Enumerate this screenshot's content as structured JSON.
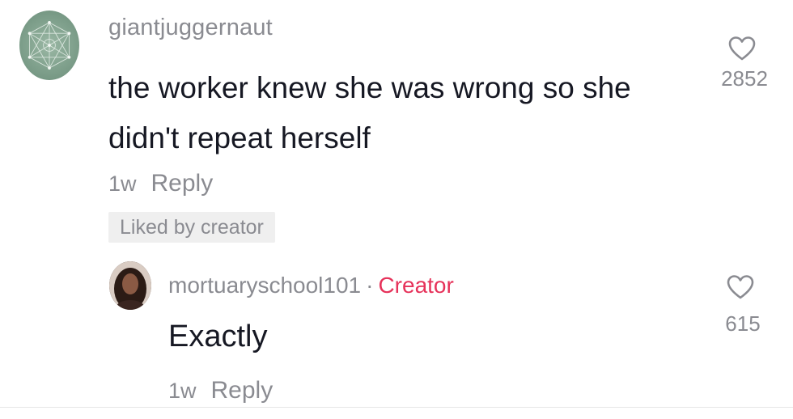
{
  "comment": {
    "username": "giantjuggernaut",
    "text": "the worker knew she was wrong so she didn't repeat herself",
    "time": "1w",
    "reply_label": "Reply",
    "liked_badge": "Liked by creator",
    "like_count": "2852",
    "avatar_icon": "sacred-geometry-avatar",
    "like_icon": "heart-outline-icon"
  },
  "reply": {
    "username": "mortuaryschool101",
    "separator": "·",
    "creator_label": "Creator",
    "text": "Exactly",
    "time": "1w",
    "reply_label": "Reply",
    "like_count": "615",
    "like_icon": "heart-outline-icon"
  },
  "colors": {
    "creator_accent": "#e6325a",
    "secondary_text": "#8a8b91",
    "primary_text": "#161823"
  }
}
